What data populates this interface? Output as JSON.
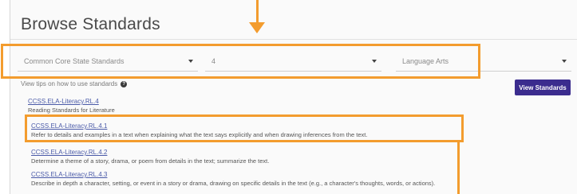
{
  "page": {
    "title": "Browse Standards"
  },
  "filters": {
    "standards_set": "Common Core State Standards",
    "grade": "4",
    "subject": "Language Arts"
  },
  "hint": {
    "text": "View tips on how to use standards"
  },
  "actions": {
    "view_standards_label": "View Standards"
  },
  "standards": {
    "parent": {
      "code": "CCSS.ELA-Literacy.RL.4",
      "desc": "Reading Standards for Literature"
    },
    "items": [
      {
        "code": "CCSS.ELA-Literacy.RL.4.1",
        "desc": "Refer to details and examples in a text when explaining what the text says explicitly and when drawing inferences from the text."
      },
      {
        "code": "CCSS.ELA-Literacy.RL.4.2",
        "desc": "Determine a theme of a story, drama, or poem from details in the text; summarize the text."
      },
      {
        "code": "CCSS.ELA-Literacy.RL.4.3",
        "desc": "Describe in depth a character, setting, or event in a story or drama, drawing on specific details in the text (e.g., a character's thoughts, words, or actions)."
      }
    ]
  },
  "colors": {
    "annotation": "#f39c2e",
    "button": "#3b2c8e",
    "link": "#4a5aa8"
  }
}
